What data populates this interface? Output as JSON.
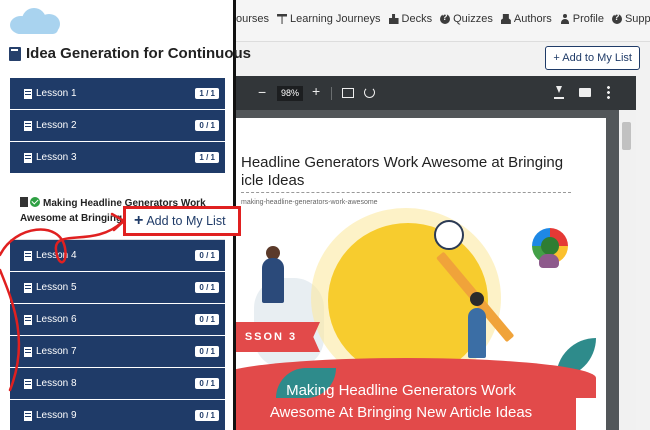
{
  "nav": {
    "items": [
      {
        "label": "ourses",
        "icon": "none"
      },
      {
        "label": "Learning Journeys",
        "icon": "signpost-icon"
      },
      {
        "label": "Decks",
        "icon": "cubes-icon"
      },
      {
        "label": "Quizzes",
        "icon": "question-circle-icon"
      },
      {
        "label": "Authors",
        "icon": "users-icon"
      },
      {
        "label": "Profile",
        "icon": "user-icon"
      },
      {
        "label": "Support",
        "icon": "question-circle-icon"
      }
    ]
  },
  "toolbar": {
    "add_to_list_label": "+ Add to My List"
  },
  "sidebar": {
    "course_title": "Idea Generation for Continuous",
    "open_lesson": {
      "title_line1": "Making Headline Generators Work",
      "title_line2": "Awesome at Bringing New Article Ideas"
    },
    "lessons": [
      {
        "label": "Lesson 1",
        "count": "1 / 1"
      },
      {
        "label": "Lesson 2",
        "count": "0 / 1"
      },
      {
        "label": "Lesson 3",
        "count": "1 / 1"
      },
      {
        "label": "Lesson 4",
        "count": "0 / 1"
      },
      {
        "label": "Lesson 5",
        "count": "0 / 1"
      },
      {
        "label": "Lesson 6",
        "count": "0 / 1"
      },
      {
        "label": "Lesson 7",
        "count": "0 / 1"
      },
      {
        "label": "Lesson 8",
        "count": "0 / 1"
      },
      {
        "label": "Lesson 9",
        "count": "0 / 1"
      }
    ]
  },
  "callout": {
    "plus": "+",
    "label": "Add to My List"
  },
  "pdf": {
    "zoom": "98%",
    "doc_title_line1": "Headline Generators Work Awesome at Bringing",
    "doc_title_line2": "icle Ideas",
    "slug": "making-headline-generators-work-awesome",
    "ribbon_text": "SSON 3",
    "hero_line1": "Making Headline Generators Work",
    "hero_line2": "Awesome At Bringing New Article Ideas"
  },
  "colors": {
    "navy": "#1f3b68",
    "annotation_red": "#e02020",
    "pdf_toolbar": "#323639"
  }
}
